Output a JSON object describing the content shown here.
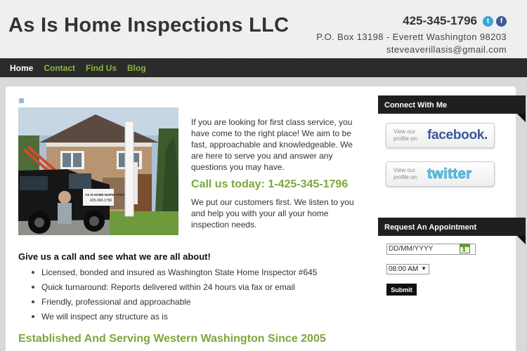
{
  "header": {
    "site_title": "As Is Home Inspections LLC",
    "phone": "425-345-1796",
    "address": "P.O. Box 13198 - Everett Washington 98203",
    "email": "steveaverillasis@gmail.com",
    "social_icons": [
      "twitter-icon",
      "facebook-icon"
    ]
  },
  "nav": {
    "items": [
      {
        "label": "Home",
        "active": true
      },
      {
        "label": "Contact",
        "active": false
      },
      {
        "label": "Find Us",
        "active": false
      },
      {
        "label": "Blog",
        "active": false
      }
    ]
  },
  "main": {
    "intro": "If you are looking for first class service, you have come to the right place! We aim to be fast, approachable and knowledgeable. We are here to serve you and answer any questions you may have.",
    "call_us": "Call us today: 1-425-345-1796",
    "we_put": "We put our customers first. We listen to you and help you with your all your home inspection needs.",
    "give_us": "Give us a call and see what we are all about!",
    "features": [
      "Licensed, bonded and insured as Washington State Home Inspector #645",
      "Quick turnaround: Reports delivered within 24 hours via fax or email",
      "Friendly, professional and approachable",
      "We will inspect any structure as is"
    ],
    "established": "Established And Serving Western Washington Since 2005",
    "photo_sign_text": [
      "AS IS HOME INSPECTIONS",
      "425-345-1796"
    ]
  },
  "sidebar": {
    "connect_title": "Connect With Me",
    "view_profile_text": "View our profile on:",
    "facebook_word": "facebook.",
    "twitter_word": "twitter",
    "appointment_title": "Request An Appointment",
    "date_placeholder": "DD/MM/YYYY",
    "time_value": "08:00 AM",
    "submit_label": "Submit"
  },
  "colors": {
    "accent_green": "#7ba83a",
    "nav_bg": "#2b2b2b",
    "facebook_blue": "#3b5998",
    "twitter_blue": "#3aa6dd"
  }
}
